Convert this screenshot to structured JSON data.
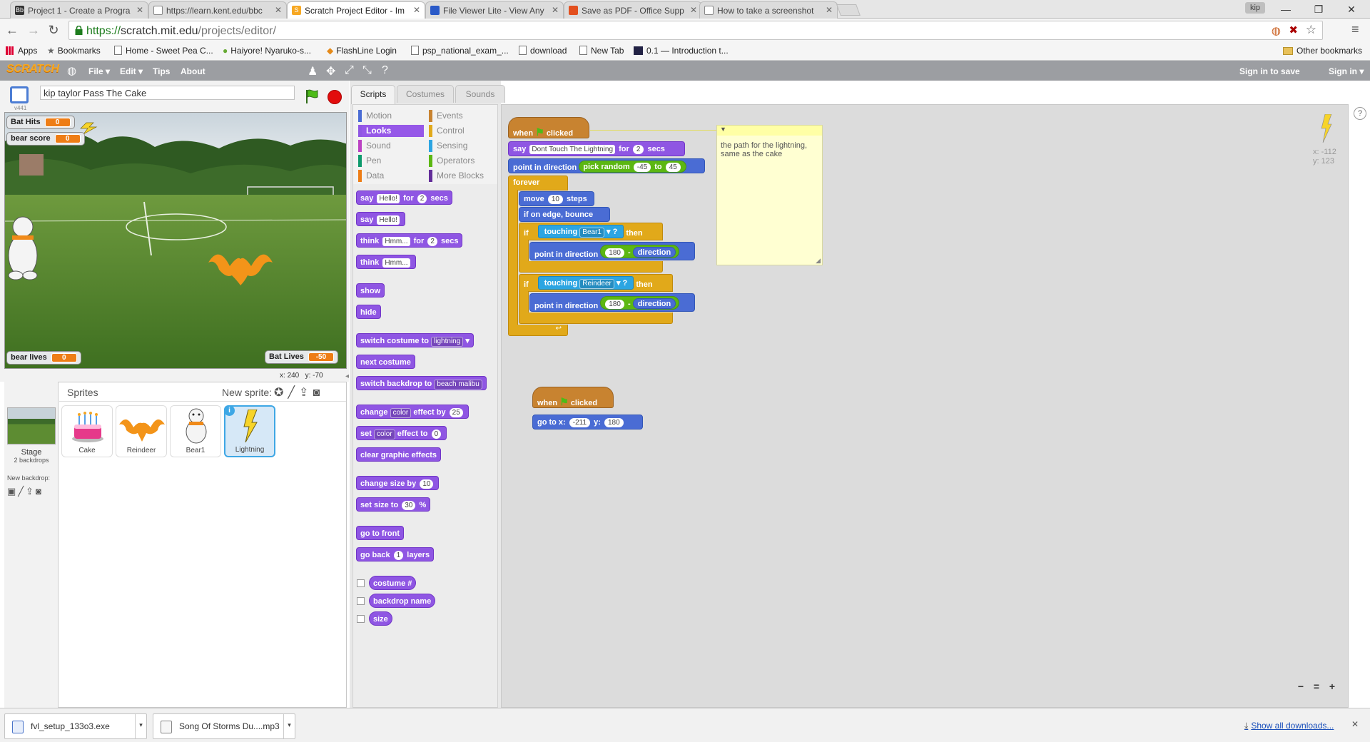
{
  "browser": {
    "tabs": [
      {
        "title": "Project 1 - Create a Progra",
        "favicon": "Bb",
        "active": false
      },
      {
        "title": "https://learn.kent.edu/bbc",
        "favicon": "page",
        "active": false
      },
      {
        "title": "Scratch Project Editor - Im",
        "favicon": "scratch",
        "active": true
      },
      {
        "title": "File Viewer Lite - View Any",
        "favicon": "fvl",
        "active": false
      },
      {
        "title": "Save as PDF - Office Supp",
        "favicon": "office",
        "active": false
      },
      {
        "title": "How to take a screenshot",
        "favicon": "page",
        "active": false
      }
    ],
    "user_badge": "kip",
    "url_scheme": "https://",
    "url_host": "scratch.mit.edu",
    "url_path": "/projects/editor/",
    "bookmarks": [
      "Apps",
      "Bookmarks",
      "Home - Sweet Pea C...",
      "Haiyore! Nyaruko-s...",
      "FlashLine Login",
      "psp_national_exam_...",
      "download",
      "New Tab",
      "0.1 — Introduction t..."
    ],
    "other_bookmarks": "Other bookmarks"
  },
  "scratch": {
    "logo": "SCRATCH",
    "menu": {
      "file": "File ▾",
      "edit": "Edit ▾",
      "tips": "Tips",
      "about": "About"
    },
    "sign_in_to_save": "Sign in to save",
    "sign_in": "Sign in ▾",
    "project_title": "kip taylor Pass The Cake",
    "version": "v441",
    "monitors": {
      "bat_hits": {
        "label": "Bat Hits",
        "value": "0"
      },
      "bear_score": {
        "label": "bear score",
        "value": "0"
      },
      "bear_lives": {
        "label": "bear lives",
        "value": "0"
      },
      "bat_lives": {
        "label": "Bat Lives",
        "value": "-50"
      }
    },
    "stage_coords": {
      "x_label": "x:",
      "x": "240",
      "y_label": "y:",
      "y": "-70"
    },
    "sprites_label": "Sprites",
    "new_sprite_label": "New sprite:",
    "stage_label": "Stage",
    "stage_backdrops": "2 backdrops",
    "new_backdrop_label": "New backdrop:",
    "sprites": [
      "Cake",
      "Reindeer",
      "Bear1",
      "Lightning"
    ],
    "tabs": {
      "scripts": "Scripts",
      "costumes": "Costumes",
      "sounds": "Sounds"
    },
    "categories": {
      "left": [
        "Motion",
        "Looks",
        "Sound",
        "Pen",
        "Data"
      ],
      "right": [
        "Events",
        "Control",
        "Sensing",
        "Operators",
        "More Blocks"
      ]
    },
    "palette": {
      "say_for": {
        "a": "say",
        "v": "Hello!",
        "b": "for",
        "n": "2",
        "c": "secs"
      },
      "say": {
        "a": "say",
        "v": "Hello!"
      },
      "think_for": {
        "a": "think",
        "v": "Hmm...",
        "b": "for",
        "n": "2",
        "c": "secs"
      },
      "think": {
        "a": "think",
        "v": "Hmm..."
      },
      "show": "show",
      "hide": "hide",
      "switch_costume": {
        "a": "switch costume to",
        "v": "lightning"
      },
      "next_costume": "next costume",
      "switch_backdrop": {
        "a": "switch backdrop to",
        "v": "beach malibu"
      },
      "change_effect": {
        "a": "change",
        "v": "color",
        "b": "effect by",
        "n": "25"
      },
      "set_effect": {
        "a": "set",
        "v": "color",
        "b": "effect to",
        "n": "0"
      },
      "clear_effects": "clear graphic effects",
      "change_size": {
        "a": "change size by",
        "n": "10"
      },
      "set_size": {
        "a": "set size to",
        "n": "30",
        "b": "%"
      },
      "go_front": "go to front",
      "go_back": {
        "a": "go back",
        "n": "1",
        "b": "layers"
      },
      "costume_num": "costume #",
      "backdrop_name": "backdrop name",
      "size": "size"
    },
    "script1": {
      "hat_when": "when",
      "hat_clicked": "clicked",
      "say": "say",
      "say_text": "Dont Touch The Lightning",
      "say_for": "for",
      "say_secs_n": "2",
      "say_secs": "secs",
      "point_dir": "point in direction",
      "pick_random": "pick random",
      "rand_from": "-45",
      "rand_to_label": "to",
      "rand_to": "45",
      "forever": "forever",
      "move": "move",
      "move_n": "10",
      "steps": "steps",
      "bounce": "if on edge, bounce",
      "if1": "if",
      "touching": "touching",
      "bear1": "Bear1",
      "q": "?",
      "then": "then",
      "point_dir2": "point in direction",
      "n180": "180",
      "minus": "-",
      "direction": "direction",
      "if2": "if",
      "touching2": "touching",
      "reindeer": "Reindeer",
      "q2": "?",
      "then2": "then",
      "point_dir3": "point in direction",
      "n180b": "180",
      "minus2": "-",
      "direction2": "direction",
      "loop_arrow": "↩"
    },
    "script2": {
      "hat_when": "when",
      "hat_clicked": "clicked",
      "goto": "go to x:",
      "x": "-211",
      "y_label": "y:",
      "y": "180"
    },
    "comment": "the path for the lightning, same as the cake",
    "sprite_coords": {
      "x": "x: -112",
      "y": "y: 123"
    },
    "zoom": {
      "out": "−",
      "reset": "=",
      "in": "+"
    }
  },
  "downloads": {
    "items": [
      "fvl_setup_133o3.exe",
      "Song Of Storms Du....mp3"
    ],
    "show_all": "Show all downloads..."
  }
}
